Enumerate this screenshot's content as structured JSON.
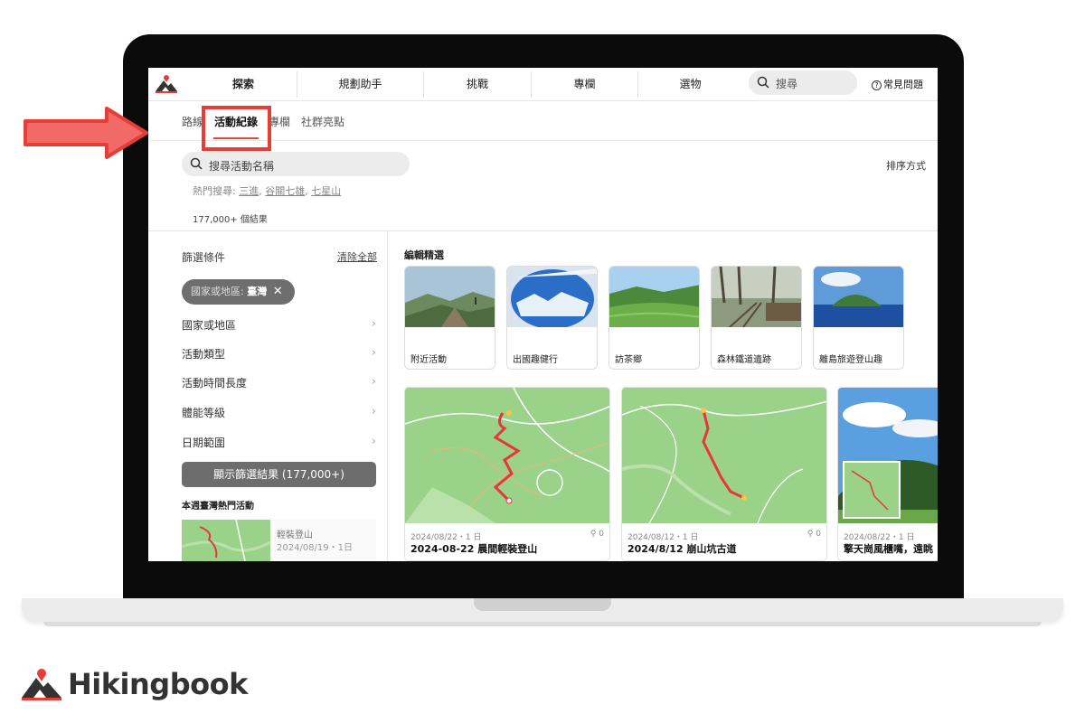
{
  "brand": {
    "name": "Hikingbook",
    "accent": "#e53d37"
  },
  "nav": {
    "items": [
      "探索",
      "規劃助手",
      "挑戰",
      "專欄",
      "選物"
    ],
    "search_placeholder": "搜尋",
    "faq": "常見問題"
  },
  "subtabs": {
    "items": [
      "路線",
      "活動紀錄",
      "專欄",
      "社群亮點"
    ],
    "active": "活動紀錄"
  },
  "search": {
    "placeholder": "搜尋活動名稱",
    "sort_label": "排序方式",
    "hot_label": "熱門搜尋:",
    "hot_terms": [
      "三進",
      "谷關七雄",
      "七星山"
    ],
    "result_count": "177,000+ 個結果"
  },
  "filters": {
    "title": "篩選條件",
    "clear_all": "清除全部",
    "chip_prefix": "國家或地區:",
    "chip_value": "臺灣",
    "chip_close": "✕",
    "rows": [
      "國家或地區",
      "活動類型",
      "活動時間長度",
      "體能等級",
      "日期範圍"
    ],
    "apply_button": "顯示篩選結果 (177,000+)"
  },
  "weekly": {
    "title": "本週臺灣熱門活動",
    "card": {
      "name": "輕裝登山",
      "date": "2024/08/19・1日"
    }
  },
  "editor_picks": {
    "title": "編輯精選",
    "items": [
      {
        "label": "附近活動",
        "image": "mountain-ridge-hiker"
      },
      {
        "label": "出國趣健行",
        "image": "airplane-window-alps"
      },
      {
        "label": "訪茶鄉",
        "image": "tea-plantation-hills"
      },
      {
        "label": "森林鐵道遺跡",
        "image": "forest-railway"
      },
      {
        "label": "離島旅遊登山趣",
        "image": "island-ocean"
      }
    ]
  },
  "activities": [
    {
      "meta": "2024/08/22・1 日",
      "likes": "0",
      "title": "2024-08-22 晨間輕裝登山"
    },
    {
      "meta": "2024/08/12・1 日",
      "likes": "0",
      "title": "2024/8/12 崩山坑古道"
    },
    {
      "meta": "2024/08/22・1 日",
      "likes": "",
      "title": "擎天崗風櫃嘴，遠眺"
    }
  ],
  "colors": {
    "map_green": "#9bd28a",
    "route_red": "#e8343a",
    "chip_bg": "#6e6e6e",
    "button_bg": "#6d6d6d"
  }
}
